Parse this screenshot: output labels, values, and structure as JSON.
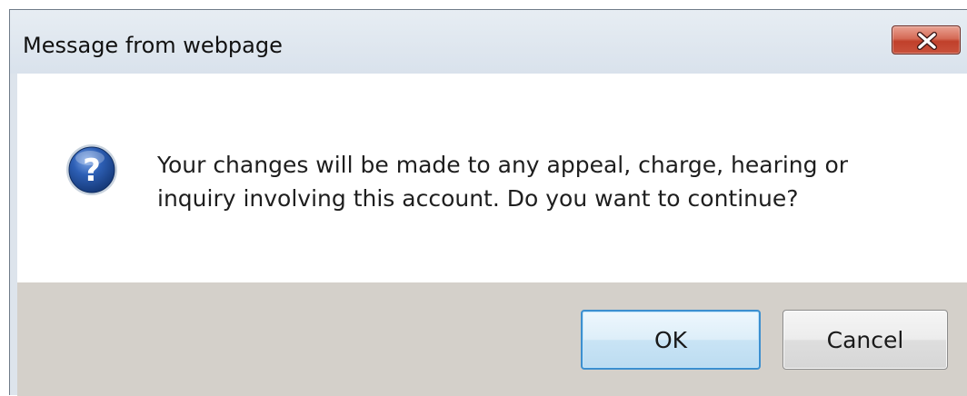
{
  "dialog": {
    "title": "Message from webpage",
    "close_icon": "close-icon",
    "icon": "question-icon",
    "icon_color": "#1f4e9a",
    "message_lines": [
      "Your changes will be made to any appeal, charge, hearing or",
      "inquiry involving this account. Do you want to continue?"
    ],
    "buttons": {
      "ok_label": "OK",
      "cancel_label": "Cancel"
    },
    "close_color": "#c9513b"
  }
}
